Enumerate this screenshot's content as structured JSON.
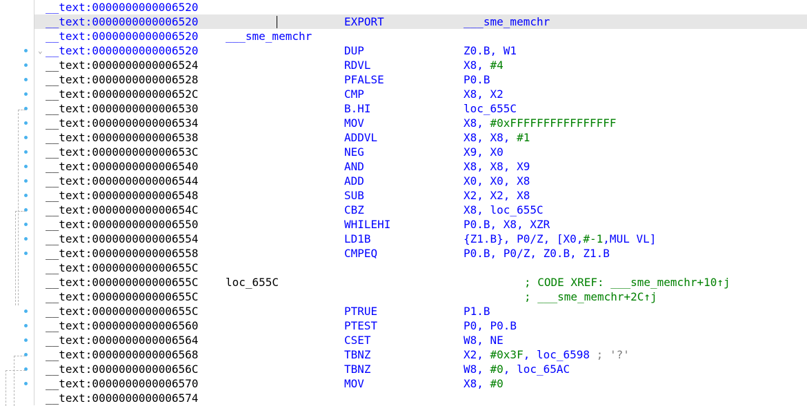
{
  "rows": [
    {
      "addr": "__text:0000000000006520",
      "label": "",
      "mnem": "",
      "ops": [],
      "comment": "",
      "style": "link"
    },
    {
      "addr": "__text:0000000000006520",
      "label": "",
      "mnem": "EXPORT",
      "ops": [
        {
          "t": "___sme_memchr",
          "k": "link"
        }
      ],
      "comment": "",
      "style": "link-selected"
    },
    {
      "addr": "__text:0000000000006520",
      "label": "___sme_memchr",
      "mnem": "",
      "ops": [],
      "comment": "",
      "style": "link"
    },
    {
      "addr": "__text:0000000000006520",
      "label": "",
      "mnem": "DUP",
      "ops": [
        {
          "t": "Z0.B, W1",
          "k": "plain"
        }
      ],
      "comment": "",
      "style": "link"
    },
    {
      "addr": "__text:0000000000006524",
      "label": "",
      "mnem": "RDVL",
      "ops": [
        {
          "t": "X8, ",
          "k": "plain"
        },
        {
          "t": "#4",
          "k": "num"
        }
      ],
      "comment": ""
    },
    {
      "addr": "__text:0000000000006528",
      "label": "",
      "mnem": "PFALSE",
      "ops": [
        {
          "t": "P0.B",
          "k": "plain"
        }
      ],
      "comment": ""
    },
    {
      "addr": "__text:000000000000652C",
      "label": "",
      "mnem": "CMP",
      "ops": [
        {
          "t": "X8, X2",
          "k": "plain"
        }
      ],
      "comment": ""
    },
    {
      "addr": "__text:0000000000006530",
      "label": "",
      "mnem": "B.HI",
      "ops": [
        {
          "t": "loc_655C",
          "k": "plain"
        }
      ],
      "comment": ""
    },
    {
      "addr": "__text:0000000000006534",
      "label": "",
      "mnem": "MOV",
      "ops": [
        {
          "t": "X8, ",
          "k": "plain"
        },
        {
          "t": "#0xFFFFFFFFFFFFFFFF",
          "k": "num"
        }
      ],
      "comment": ""
    },
    {
      "addr": "__text:0000000000006538",
      "label": "",
      "mnem": "ADDVL",
      "ops": [
        {
          "t": "X8, X8, ",
          "k": "plain"
        },
        {
          "t": "#1",
          "k": "num"
        }
      ],
      "comment": ""
    },
    {
      "addr": "__text:000000000000653C",
      "label": "",
      "mnem": "NEG",
      "ops": [
        {
          "t": "X9, X0",
          "k": "plain"
        }
      ],
      "comment": ""
    },
    {
      "addr": "__text:0000000000006540",
      "label": "",
      "mnem": "AND",
      "ops": [
        {
          "t": "X8, X8, X9",
          "k": "plain"
        }
      ],
      "comment": ""
    },
    {
      "addr": "__text:0000000000006544",
      "label": "",
      "mnem": "ADD",
      "ops": [
        {
          "t": "X0, X0, X8",
          "k": "plain"
        }
      ],
      "comment": ""
    },
    {
      "addr": "__text:0000000000006548",
      "label": "",
      "mnem": "SUB",
      "ops": [
        {
          "t": "X2, X2, X8",
          "k": "plain"
        }
      ],
      "comment": ""
    },
    {
      "addr": "__text:000000000000654C",
      "label": "",
      "mnem": "CBZ",
      "ops": [
        {
          "t": "X8, loc_655C",
          "k": "plain"
        }
      ],
      "comment": ""
    },
    {
      "addr": "__text:0000000000006550",
      "label": "",
      "mnem": "WHILEHI",
      "ops": [
        {
          "t": "P0.B, X8, XZR",
          "k": "plain"
        }
      ],
      "comment": ""
    },
    {
      "addr": "__text:0000000000006554",
      "label": "",
      "mnem": "LD1B",
      "ops": [
        {
          "t": "{Z1.B}, P0/Z, [X0,",
          "k": "plain"
        },
        {
          "t": "#-1",
          "k": "num"
        },
        {
          "t": ",MUL VL]",
          "k": "plain"
        }
      ],
      "comment": ""
    },
    {
      "addr": "__text:0000000000006558",
      "label": "",
      "mnem": "CMPEQ",
      "ops": [
        {
          "t": "P0.B, P0/Z, Z0.B, Z1.B",
          "k": "plain"
        }
      ],
      "comment": ""
    },
    {
      "addr": "__text:000000000000655C",
      "label": "",
      "mnem": "",
      "ops": [],
      "comment": ""
    },
    {
      "addr": "__text:000000000000655C",
      "label": "loc_655C",
      "mnem": "",
      "ops": [],
      "comment": "; CODE XREF: ___sme_memchr+10↑j"
    },
    {
      "addr": "__text:000000000000655C",
      "label": "",
      "mnem": "",
      "ops": [],
      "comment": "; ___sme_memchr+2C↑j"
    },
    {
      "addr": "__text:000000000000655C",
      "label": "",
      "mnem": "PTRUE",
      "ops": [
        {
          "t": "P1.B",
          "k": "plain"
        }
      ],
      "comment": ""
    },
    {
      "addr": "__text:0000000000006560",
      "label": "",
      "mnem": "PTEST",
      "ops": [
        {
          "t": "P0, P0.B",
          "k": "plain"
        }
      ],
      "comment": ""
    },
    {
      "addr": "__text:0000000000006564",
      "label": "",
      "mnem": "CSET",
      "ops": [
        {
          "t": "W8, NE",
          "k": "plain"
        }
      ],
      "comment": ""
    },
    {
      "addr": "__text:0000000000006568",
      "label": "",
      "mnem": "TBNZ",
      "ops": [
        {
          "t": "X2, ",
          "k": "plain"
        },
        {
          "t": "#0x3F",
          "k": "num"
        },
        {
          "t": ", loc_6598 ",
          "k": "plain"
        },
        {
          "t": "; '?'",
          "k": "str"
        }
      ],
      "comment": ""
    },
    {
      "addr": "__text:000000000000656C",
      "label": "",
      "mnem": "TBNZ",
      "ops": [
        {
          "t": "W8, ",
          "k": "plain"
        },
        {
          "t": "#0",
          "k": "num"
        },
        {
          "t": ", loc_65AC",
          "k": "plain"
        }
      ],
      "comment": ""
    },
    {
      "addr": "__text:0000000000006570",
      "label": "",
      "mnem": "MOV",
      "ops": [
        {
          "t": "X8, ",
          "k": "plain"
        },
        {
          "t": "#0",
          "k": "num"
        }
      ],
      "comment": ""
    },
    {
      "addr": "__text:0000000000006574",
      "label": "",
      "mnem": "",
      "ops": [],
      "comment": ""
    }
  ],
  "dot_rows": [
    3,
    4,
    5,
    6,
    7,
    8,
    9,
    10,
    11,
    12,
    13,
    14,
    15,
    16,
    17,
    21,
    22,
    23,
    24,
    25,
    26
  ]
}
